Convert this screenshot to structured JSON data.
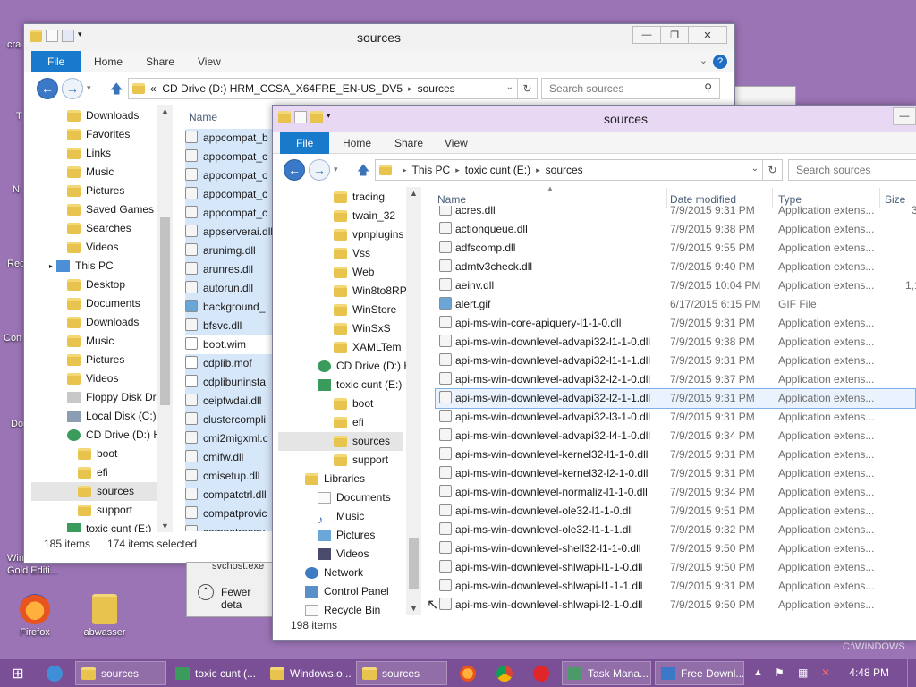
{
  "desktop": {
    "icons": [
      {
        "label": "Firefox"
      },
      {
        "label": "abwasser"
      }
    ],
    "fragments": [
      "cra",
      "T",
      "N",
      "Rec",
      "Con",
      "Do",
      "Windows 8",
      "Gold Editi..."
    ],
    "watermark": "C:\\WINDOWS"
  },
  "window1": {
    "title": "sources",
    "tabs": [
      "File",
      "Home",
      "Share",
      "View"
    ],
    "address": "CD Drive (D:) HRM_CCSA_X64FRE_EN-US_DV5",
    "address_leaf": "sources",
    "address_prefix": "«",
    "search_placeholder": "Search sources",
    "nav": [
      "Downloads",
      "Favorites",
      "Links",
      "Music",
      "Pictures",
      "Saved Games",
      "Searches",
      "Videos",
      "This PC",
      "Desktop",
      "Documents",
      "Downloads",
      "Music",
      "Pictures",
      "Videos",
      "Floppy Disk Dri",
      "Local Disk (C:)",
      "CD Drive (D:) H",
      "boot",
      "efi",
      "sources",
      "support",
      "toxic cunt (E:)"
    ],
    "column_name": "Name",
    "files": [
      "appcompat_b",
      "appcompat_c",
      "appcompat_c",
      "appcompat_c",
      "appcompat_c",
      "appserverai.dll",
      "arunimg.dll",
      "arunres.dll",
      "autorun.dll",
      "background_",
      "bfsvc.dll",
      "boot.wim",
      "cdplib.mof",
      "cdplibuninsta",
      "ceipfwdai.dll",
      "clustercompli",
      "cmi2migxml.c",
      "cmifw.dll",
      "cmisetup.dll",
      "compatctrl.dll",
      "compatprovic",
      "compatresou"
    ],
    "status_count": "185 items",
    "status_selected": "174 items selected",
    "behind_item": "svchost.exe",
    "fewer_details": "Fewer deta"
  },
  "window2": {
    "title": "sources",
    "tabs": [
      "File",
      "Home",
      "Share",
      "View"
    ],
    "crumbs": [
      "This PC",
      "toxic cunt (E:)",
      "sources"
    ],
    "search_placeholder": "Search sources",
    "nav": [
      "tracing",
      "twain_32",
      "vpnplugins",
      "Vss",
      "Web",
      "Win8to8RP",
      "WinStore",
      "WinSxS",
      "XAMLTem",
      "CD Drive (D:) H",
      "toxic cunt (E:)",
      "boot",
      "efi",
      "sources",
      "support",
      "Libraries",
      "Documents",
      "Music",
      "Pictures",
      "Videos",
      "Network",
      "Control Panel",
      "Recycle Bin"
    ],
    "columns": {
      "name": "Name",
      "date": "Date modified",
      "type": "Type",
      "size": "Size"
    },
    "files": [
      {
        "name": "acres.dll",
        "date": "7/9/2015 9:31 PM",
        "type": "Application extens...",
        "size": "3"
      },
      {
        "name": "actionqueue.dll",
        "date": "7/9/2015 9:38 PM",
        "type": "Application extens...",
        "size": ""
      },
      {
        "name": "adfscomp.dll",
        "date": "7/9/2015 9:55 PM",
        "type": "Application extens...",
        "size": ""
      },
      {
        "name": "admtv3check.dll",
        "date": "7/9/2015 9:40 PM",
        "type": "Application extens...",
        "size": ""
      },
      {
        "name": "aeinv.dll",
        "date": "7/9/2015 10:04 PM",
        "type": "Application extens...",
        "size": "1,1"
      },
      {
        "name": "alert.gif",
        "date": "6/17/2015 6:15 PM",
        "type": "GIF File",
        "size": ""
      },
      {
        "name": "api-ms-win-core-apiquery-l1-1-0.dll",
        "date": "7/9/2015 9:31 PM",
        "type": "Application extens...",
        "size": ""
      },
      {
        "name": "api-ms-win-downlevel-advapi32-l1-1-0.dll",
        "date": "7/9/2015 9:38 PM",
        "type": "Application extens...",
        "size": ""
      },
      {
        "name": "api-ms-win-downlevel-advapi32-l1-1-1.dll",
        "date": "7/9/2015 9:31 PM",
        "type": "Application extens...",
        "size": ""
      },
      {
        "name": "api-ms-win-downlevel-advapi32-l2-1-0.dll",
        "date": "7/9/2015 9:37 PM",
        "type": "Application extens...",
        "size": ""
      },
      {
        "name": "api-ms-win-downlevel-advapi32-l2-1-1.dll",
        "date": "7/9/2015 9:31 PM",
        "type": "Application extens...",
        "size": ""
      },
      {
        "name": "api-ms-win-downlevel-advapi32-l3-1-0.dll",
        "date": "7/9/2015 9:31 PM",
        "type": "Application extens...",
        "size": ""
      },
      {
        "name": "api-ms-win-downlevel-advapi32-l4-1-0.dll",
        "date": "7/9/2015 9:34 PM",
        "type": "Application extens...",
        "size": ""
      },
      {
        "name": "api-ms-win-downlevel-kernel32-l1-1-0.dll",
        "date": "7/9/2015 9:31 PM",
        "type": "Application extens...",
        "size": ""
      },
      {
        "name": "api-ms-win-downlevel-kernel32-l2-1-0.dll",
        "date": "7/9/2015 9:31 PM",
        "type": "Application extens...",
        "size": ""
      },
      {
        "name": "api-ms-win-downlevel-normaliz-l1-1-0.dll",
        "date": "7/9/2015 9:34 PM",
        "type": "Application extens...",
        "size": ""
      },
      {
        "name": "api-ms-win-downlevel-ole32-l1-1-0.dll",
        "date": "7/9/2015 9:51 PM",
        "type": "Application extens...",
        "size": ""
      },
      {
        "name": "api-ms-win-downlevel-ole32-l1-1-1.dll",
        "date": "7/9/2015 9:32 PM",
        "type": "Application extens...",
        "size": ""
      },
      {
        "name": "api-ms-win-downlevel-shell32-l1-1-0.dll",
        "date": "7/9/2015 9:50 PM",
        "type": "Application extens...",
        "size": ""
      },
      {
        "name": "api-ms-win-downlevel-shlwapi-l1-1-0.dll",
        "date": "7/9/2015 9:50 PM",
        "type": "Application extens...",
        "size": ""
      },
      {
        "name": "api-ms-win-downlevel-shlwapi-l1-1-1.dll",
        "date": "7/9/2015 9:31 PM",
        "type": "Application extens...",
        "size": ""
      },
      {
        "name": "api-ms-win-downlevel-shlwapi-l2-1-0.dll",
        "date": "7/9/2015 9:50 PM",
        "type": "Application extens...",
        "size": ""
      }
    ],
    "status_count": "198 items"
  },
  "taskbar": {
    "items": [
      "sources",
      "toxic cunt (...",
      "Windows.o...",
      "sources",
      "Task Mana...",
      "Free Downl..."
    ],
    "clock": "4:48 PM"
  },
  "colors": {
    "desktop": "#9b74b6",
    "taskbar": "#7a4f96",
    "file_tab": "#1979ca",
    "title2": "#e9d8f4"
  }
}
